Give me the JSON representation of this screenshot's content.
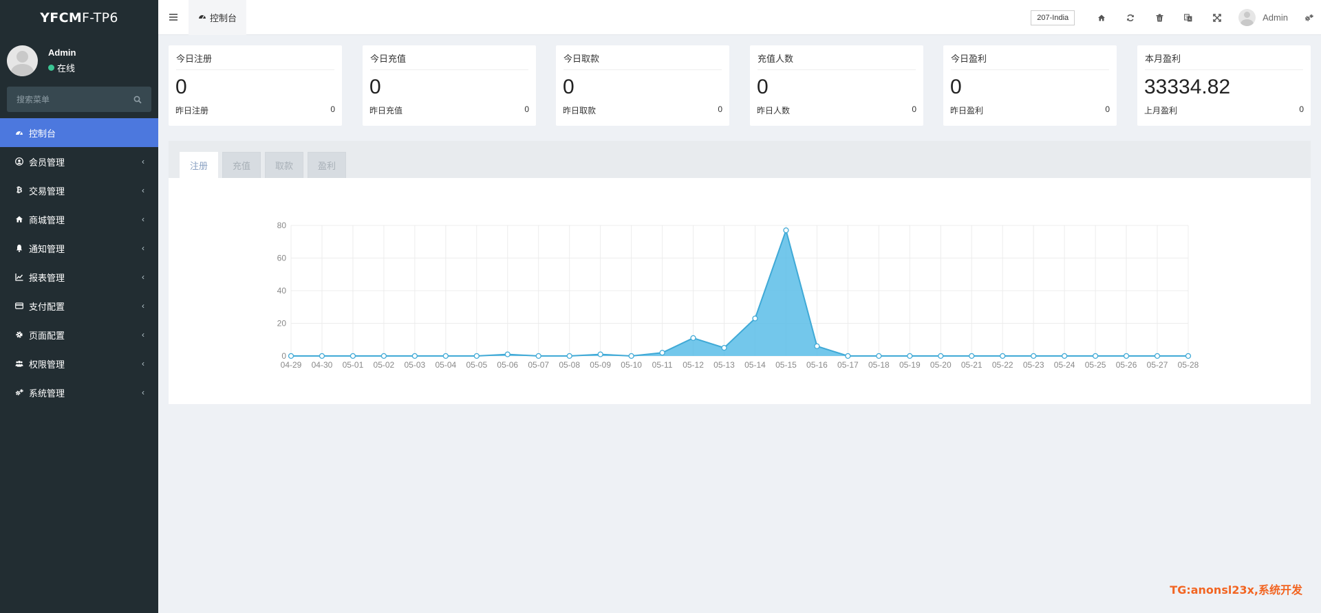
{
  "sidebar": {
    "logo_bold": "YFCM",
    "logo_light": "F-TP6",
    "user": {
      "name": "Admin",
      "status": "在线"
    },
    "search_placeholder": "搜索菜单",
    "items": [
      {
        "label": "控制台",
        "icon": "dashboard-icon",
        "active": true
      },
      {
        "label": "会员管理",
        "icon": "user-circle-icon"
      },
      {
        "label": "交易管理",
        "icon": "bitcoin-icon"
      },
      {
        "label": "商城管理",
        "icon": "home-icon"
      },
      {
        "label": "通知管理",
        "icon": "bell-icon"
      },
      {
        "label": "报表管理",
        "icon": "line-chart-icon"
      },
      {
        "label": "支付配置",
        "icon": "credit-card-icon"
      },
      {
        "label": "页面配置",
        "icon": "gear-icon"
      },
      {
        "label": "权限管理",
        "icon": "users-icon"
      },
      {
        "label": "系统管理",
        "icon": "gears-icon"
      }
    ]
  },
  "header": {
    "tab_label": "控制台",
    "region": "207-India",
    "admin_name": "Admin"
  },
  "cards": [
    {
      "title": "今日注册",
      "value": "0",
      "foot_label": "昨日注册",
      "foot_value": "0"
    },
    {
      "title": "今日充值",
      "value": "0",
      "foot_label": "昨日充值",
      "foot_value": "0"
    },
    {
      "title": "今日取款",
      "value": "0",
      "foot_label": "昨日取款",
      "foot_value": "0"
    },
    {
      "title": "充值人数",
      "value": "0",
      "foot_label": "昨日人数",
      "foot_value": "0"
    },
    {
      "title": "今日盈利",
      "value": "0",
      "foot_label": "昨日盈利",
      "foot_value": "0"
    },
    {
      "title": "本月盈利",
      "value": "33334.82",
      "foot_label": "上月盈利",
      "foot_value": "0"
    }
  ],
  "chart_tabs": [
    {
      "label": "注册",
      "active": true
    },
    {
      "label": "充值"
    },
    {
      "label": "取款"
    },
    {
      "label": "盈利"
    }
  ],
  "chart_data": {
    "type": "area",
    "categories": [
      "04-29",
      "04-30",
      "05-01",
      "05-02",
      "05-03",
      "05-04",
      "05-05",
      "05-06",
      "05-07",
      "05-08",
      "05-09",
      "05-10",
      "05-11",
      "05-12",
      "05-13",
      "05-14",
      "05-15",
      "05-16",
      "05-17",
      "05-18",
      "05-19",
      "05-20",
      "05-21",
      "05-22",
      "05-23",
      "05-24",
      "05-25",
      "05-26",
      "05-27",
      "05-28"
    ],
    "series": [
      {
        "values": [
          0,
          0,
          0,
          0,
          0,
          0,
          0,
          1,
          0,
          0,
          1,
          0,
          2,
          11,
          5,
          23,
          77,
          6,
          0,
          0,
          0,
          0,
          0,
          0,
          0,
          0,
          0,
          0,
          0,
          0
        ]
      }
    ],
    "ylim": [
      0,
      80
    ],
    "yticks": [
      0,
      20,
      40,
      60,
      80
    ],
    "grid": true,
    "color": "#5bbde8"
  },
  "watermark": "TG:anonsl23x,系统开发"
}
